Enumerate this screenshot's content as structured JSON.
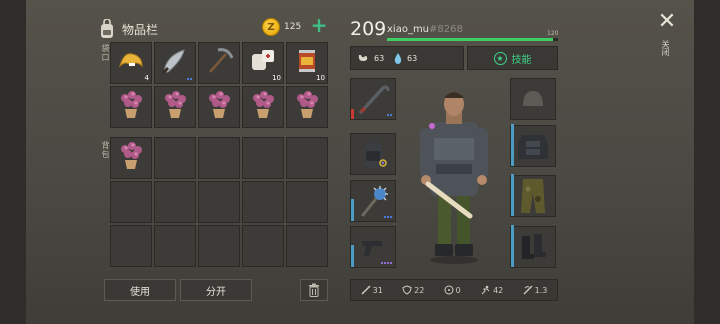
{
  "inventory": {
    "title": "物品栏",
    "coins": "125",
    "pocket_label": "袋口",
    "backpack_label": "背包",
    "pocket_items": [
      {
        "icon": "fortune-cookie-icon",
        "count": "4",
        "dots": 0
      },
      {
        "icon": "machete-icon",
        "count": "",
        "dots": 2
      },
      {
        "icon": "pickaxe-icon",
        "count": "",
        "dots": 0
      },
      {
        "icon": "bandage-icon",
        "count": "10",
        "dots": 0
      },
      {
        "icon": "canned-food-icon",
        "count": "10",
        "dots": 0
      },
      {
        "icon": "potted-flower-icon",
        "count": "",
        "dots": 0
      },
      {
        "icon": "potted-flower-icon",
        "count": "",
        "dots": 0
      },
      {
        "icon": "potted-flower-icon",
        "count": "",
        "dots": 0
      },
      {
        "icon": "potted-flower-icon",
        "count": "",
        "dots": 0
      },
      {
        "icon": "potted-flower-icon",
        "count": "",
        "dots": 0
      }
    ],
    "backpack_items": [
      {
        "icon": "potted-flower-icon",
        "count": "",
        "dots": 0
      }
    ],
    "use_button": "使用",
    "split_button": "分开"
  },
  "character": {
    "level": "209",
    "username": "xiao_mu",
    "user_tag": "#8268",
    "hp_max": "120",
    "hp_fraction": 0.97,
    "food": "63",
    "water": "63",
    "skills_label": "技能"
  },
  "stats": {
    "attack": "31",
    "defense": "22",
    "radiation": "0",
    "speed": "42",
    "weapon_speed": "1.3"
  },
  "close_label": "关闭",
  "colors": {
    "accent_green": "#3fd486",
    "hp_green": "#3dcf62",
    "rarity_blue": "#4a7bd9"
  }
}
